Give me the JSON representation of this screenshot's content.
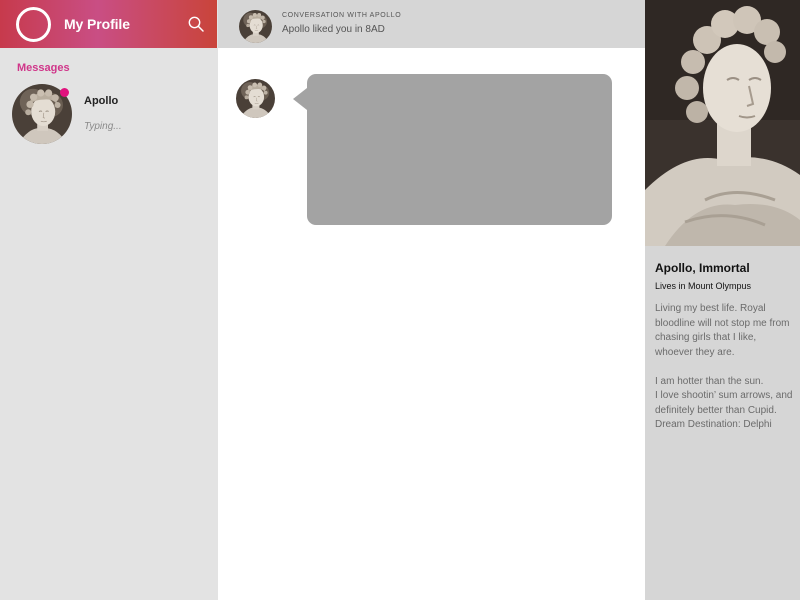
{
  "sidebar": {
    "profile_title": "My Profile",
    "messages_heading": "Messages",
    "contacts": [
      {
        "name": "Apollo",
        "status": "Typing...",
        "online": true
      }
    ]
  },
  "chat": {
    "header_label": "CONVERSATION WITH APOLLO",
    "header_sub": "Apollo liked you in 8AD"
  },
  "details": {
    "name": "Apollo, Immortal",
    "location": "Lives in Mount Olympus",
    "bio_paragraph_1": "Living my best life. Royal bloodline will not stop me from chasing girls that I like, whoever they are.",
    "bio_line_1": "I am hotter than the sun.",
    "bio_line_2": "I love shootin’ sum arrows, and definitely better than Cupid.",
    "bio_line_3": "Dream Destination: Delphi"
  },
  "colors": {
    "accent_pink": "#d0368a",
    "online_dot": "#e0127d",
    "header_gradient_start": "#c73a4c",
    "header_gradient_end": "#c9443a",
    "bubble": "#a3a3a3"
  },
  "icons": {
    "profile": "profile-ring-icon",
    "search": "search-icon"
  }
}
